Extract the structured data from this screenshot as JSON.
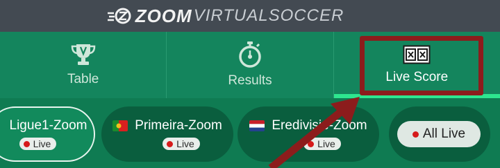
{
  "header": {
    "brand_bold": "ZOOM",
    "brand_rest": "VIRTUALSOCCER",
    "logo_icon": "zz-speed-logo-icon"
  },
  "tabs": [
    {
      "label": "Table",
      "icon": "trophy-icon",
      "active": false
    },
    {
      "label": "Results",
      "icon": "stopwatch-icon",
      "active": false
    },
    {
      "label": "Live Score",
      "icon": "scoreboard-icon",
      "active": true
    }
  ],
  "leagues": [
    {
      "name": "Ligue1-Zoom",
      "flag": "",
      "badge": "Live",
      "selected": true
    },
    {
      "name": "Primeira-Zoom",
      "flag": "portugal-flag",
      "badge": "Live",
      "selected": false
    },
    {
      "name": "Eredivisie-Zoom",
      "flag": "netherlands-flag",
      "badge": "Live",
      "selected": false
    }
  ],
  "all_live": {
    "label": "All Live"
  },
  "annotation": {
    "highlight_color": "#8c1c1c",
    "arrow_color": "#8c1c1c"
  },
  "colors": {
    "accent": "#2ee68f",
    "header_bg": "#434a52",
    "tabs_bg": "#14855d",
    "live_dot": "#d61b1b"
  }
}
